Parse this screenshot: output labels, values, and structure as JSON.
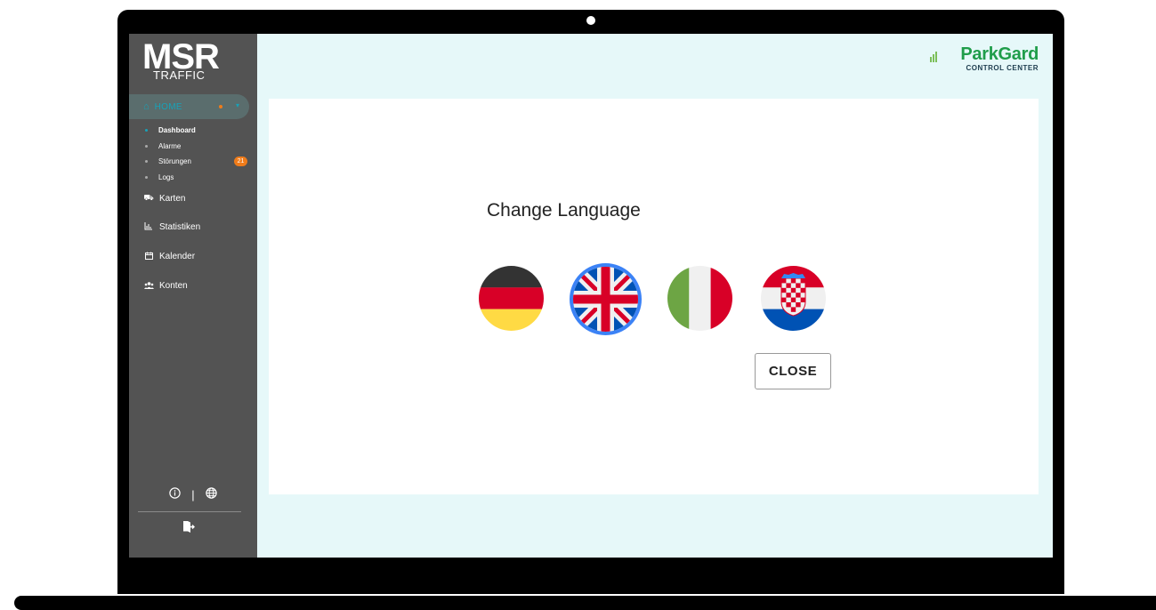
{
  "sidebar": {
    "logo": {
      "main": "MSR",
      "sub": "TRAFFIC"
    },
    "home": {
      "label": "HOME",
      "icon": "home-icon"
    },
    "subnav": [
      {
        "label": "Dashboard"
      },
      {
        "label": "Alarme"
      },
      {
        "label": "Störungen",
        "badge": "21"
      },
      {
        "label": "Logs"
      }
    ],
    "nav": [
      {
        "label": "Karten",
        "icon": "map-icon"
      },
      {
        "label": "Statistiken",
        "icon": "chart-icon"
      },
      {
        "label": "Kalender",
        "icon": "calendar-icon"
      },
      {
        "label": "Konten",
        "icon": "users-icon"
      }
    ],
    "footer": {
      "info_icon": "info-icon",
      "separator": "|",
      "globe_icon": "globe-icon",
      "logout_icon": "logout-icon"
    }
  },
  "brand": {
    "name": "ParkGard",
    "sub": "CONTROL CENTER"
  },
  "dialog": {
    "title": "Change Language",
    "languages": [
      {
        "code": "de",
        "flag_icon": "germany-flag-icon"
      },
      {
        "code": "en",
        "flag_icon": "uk-flag-icon",
        "selected": true
      },
      {
        "code": "it",
        "flag_icon": "italy-flag-icon"
      },
      {
        "code": "hr",
        "flag_icon": "croatia-flag-icon"
      }
    ],
    "close_label": "CLOSE"
  },
  "colors": {
    "sidebar_bg": "#535353",
    "accent": "#17a2b8",
    "badge": "#f07c1a",
    "screen_bg": "#e6f8f9",
    "brand_green": "#1f9d4a",
    "selected_ring": "#3b82f6"
  }
}
